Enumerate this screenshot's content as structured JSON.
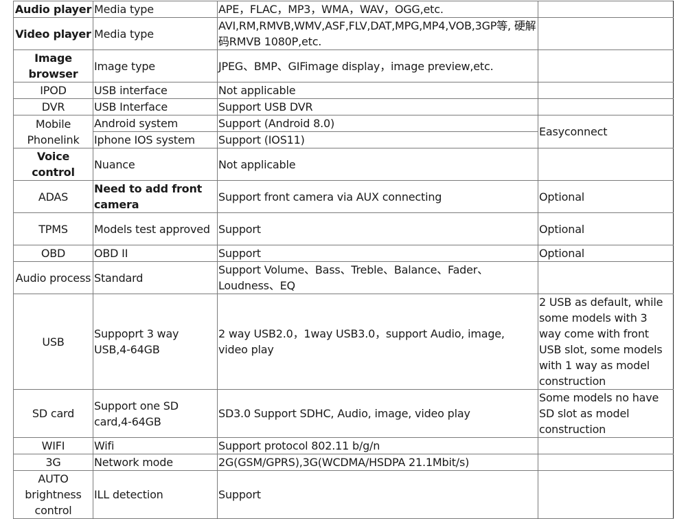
{
  "table": {
    "rows": [
      {
        "feature": "Audio player",
        "feature_bold": true,
        "type": "Media type",
        "spec": "APE，FLAC，MP3，WMA，WAV，OGG,etc.",
        "note": ""
      },
      {
        "feature": "Video player",
        "feature_bold": true,
        "type": "Media type",
        "spec": "AVI,RM,RMVB,WMV,ASF,FLV,DAT,MPG,MP4,VOB,3GP等, 硬解码RMVB 1080P,etc.",
        "note": ""
      },
      {
        "feature": "Image browser",
        "feature_bold": true,
        "type": "Image type",
        "spec": "JPEG、BMP、GIFimage display，image preview,etc.",
        "note": ""
      },
      {
        "feature": "IPOD",
        "type": "USB interface",
        "spec": "Not applicable",
        "note": ""
      },
      {
        "feature": "DVR",
        "type": "USB Interface",
        "spec": "Support USB DVR",
        "note": ""
      },
      {
        "feature": "Mobile Phonelink",
        "type": "Android system",
        "spec": "Support (Android 8.0)",
        "note": "Easyconnect"
      },
      {
        "type": "Iphone IOS system",
        "spec": "Support (IOS11)"
      },
      {
        "feature": "Voice control",
        "feature_bold": true,
        "type": "Nuance",
        "spec": "Not applicable",
        "note": ""
      },
      {
        "feature": "ADAS",
        "type": "Need to add front camera",
        "type_bold": true,
        "spec": "Support front camera via AUX connecting",
        "note": "Optional"
      },
      {
        "feature": "TPMS",
        "type": "Models test approved",
        "spec": "Support",
        "note": "Optional"
      },
      {
        "feature": "OBD",
        "type": "OBD II",
        "spec": "Support",
        "note": "Optional"
      },
      {
        "feature": "Audio process",
        "type": "Standard",
        "spec": "Support Volume、Bass、Treble、Balance、Fader、Loudness、EQ",
        "note": ""
      },
      {
        "feature": "USB",
        "type": "Suppoprt 3 way USB,4-64GB",
        "spec": "2 way USB2.0，1way USB3.0，support Audio, image, video play",
        "note": "2 USB as default, while some models with 3 way come with front USB slot, some models with 1 way as model construction"
      },
      {
        "feature": "SD card",
        "type": "Support one SD card,4-64GB",
        "spec": "SD3.0 Support SDHC, Audio, image, video play",
        "note": "Some models no have SD slot as model construction"
      },
      {
        "feature": "WIFI",
        "type": "Wifi",
        "spec": "Support protocol 802.11 b/g/n",
        "note": ""
      },
      {
        "feature": "3G",
        "type": "Network mode",
        "spec": "2G(GSM/GPRS),3G(WCDMA/HSDPA 21.1Mbit/s)",
        "note": ""
      },
      {
        "feature": "AUTO brightness control",
        "type": "ILL detection",
        "spec": "Support",
        "note": ""
      }
    ]
  }
}
